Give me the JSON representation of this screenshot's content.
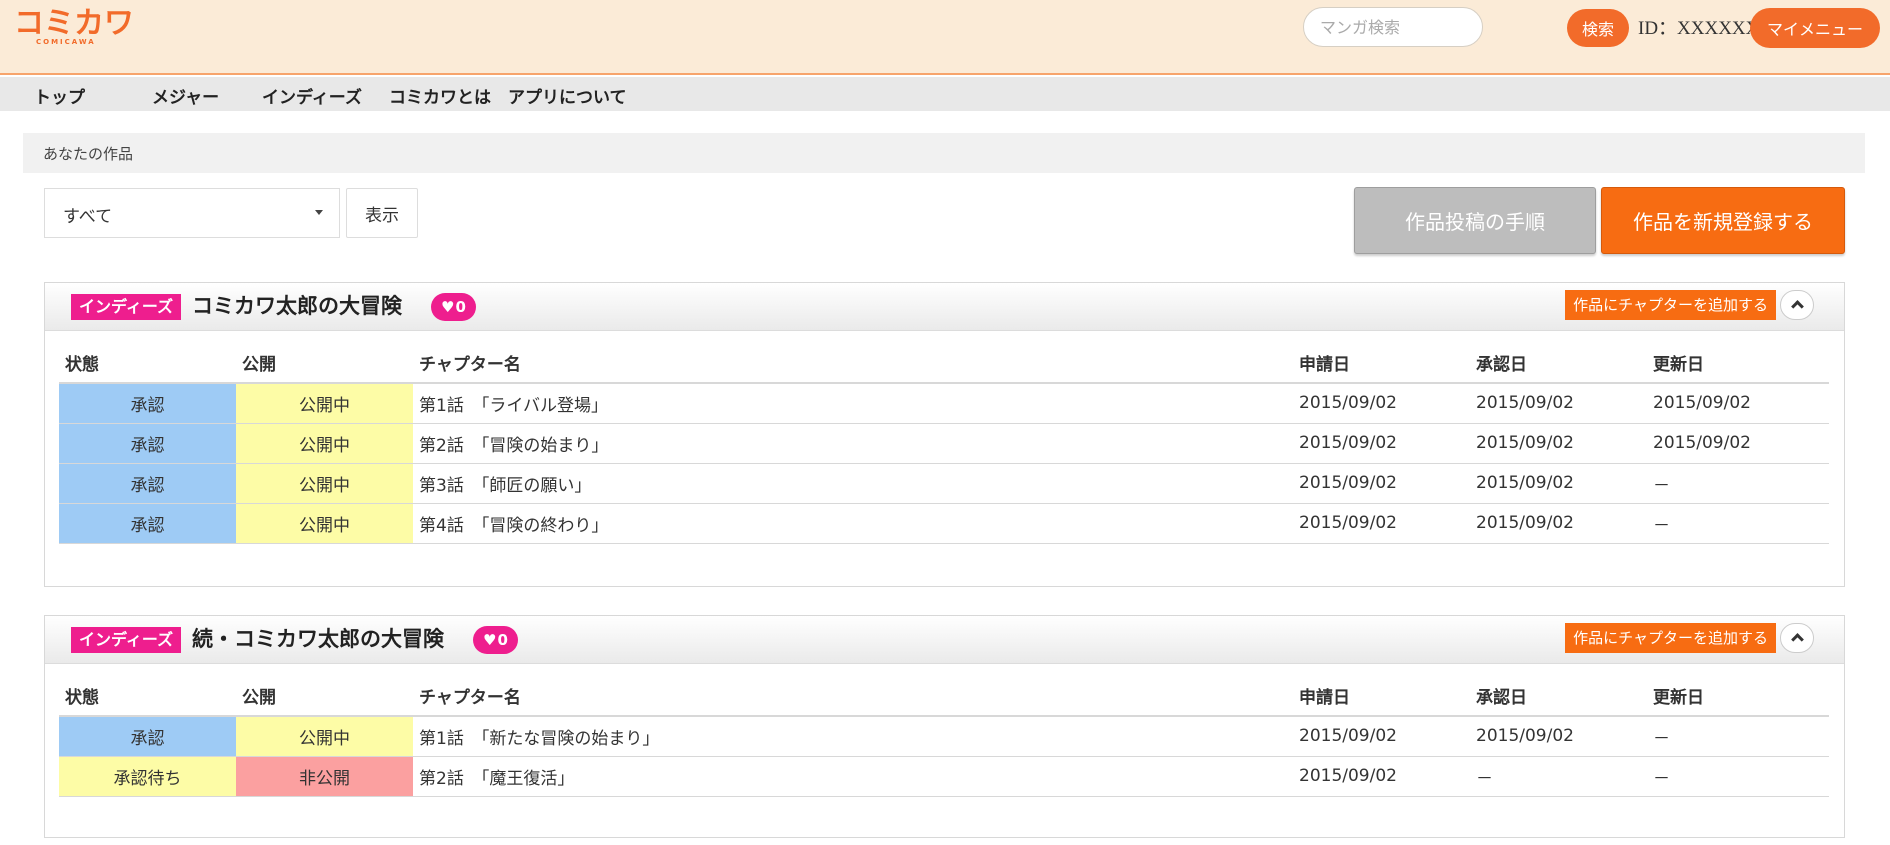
{
  "header": {
    "logo_text": "コミカワ",
    "logo_sub": "COMICAWA",
    "search_placeholder": "マンガ検索",
    "search_button": "検索",
    "user_id": "ID：XXXXXX",
    "mymenu_button": "マイメニュー",
    "colors": {
      "background": "#fbebd7",
      "accent": "#f26b2a"
    }
  },
  "nav": {
    "items": [
      "トップ",
      "メジャー",
      "インディーズ",
      "コミカワとは",
      "アプリについて"
    ]
  },
  "breadcrumb": "あなたの作品",
  "controls": {
    "filter_selected": "すべて",
    "display_button": "表示",
    "guide_button": "作品投稿の手順",
    "new_work_button": "作品を新規登録する"
  },
  "table_headers": {
    "status": "状態",
    "public": "公開",
    "chapter": "チャプター名",
    "applied": "申請日",
    "approved": "承認日",
    "updated": "更新日"
  },
  "works": [
    {
      "tag": "インディーズ",
      "title": "コミカワ太郎の大冒険",
      "likes": "0",
      "add_chapter_button": "作品にチャプターを追加する",
      "rows": [
        {
          "status": "承認",
          "status_color": "#9ecbf5",
          "public": "公開中",
          "public_color": "#fdfca6",
          "chapter": "第1話　「ライバル登場」",
          "applied": "2015/09/02",
          "approved": "2015/09/02",
          "updated": "2015/09/02"
        },
        {
          "status": "承認",
          "status_color": "#9ecbf5",
          "public": "公開中",
          "public_color": "#fdfca6",
          "chapter": "第2話　「冒険の始まり」",
          "applied": "2015/09/02",
          "approved": "2015/09/02",
          "updated": "2015/09/02"
        },
        {
          "status": "承認",
          "status_color": "#9ecbf5",
          "public": "公開中",
          "public_color": "#fdfca6",
          "chapter": "第3話　「師匠の願い」",
          "applied": "2015/09/02",
          "approved": "2015/09/02",
          "updated": "－"
        },
        {
          "status": "承認",
          "status_color": "#9ecbf5",
          "public": "公開中",
          "public_color": "#fdfca6",
          "chapter": "第4話　「冒険の終わり」",
          "applied": "2015/09/02",
          "approved": "2015/09/02",
          "updated": "－"
        }
      ]
    },
    {
      "tag": "インディーズ",
      "title": "続・コミカワ太郎の大冒険",
      "likes": "0",
      "add_chapter_button": "作品にチャプターを追加する",
      "rows": [
        {
          "status": "承認",
          "status_color": "#9ecbf5",
          "public": "公開中",
          "public_color": "#fdfca6",
          "chapter": "第1話　「新たな冒険の始まり」",
          "applied": "2015/09/02",
          "approved": "2015/09/02",
          "updated": "－"
        },
        {
          "status": "承認待ち",
          "status_color": "#fdfca6",
          "public": "非公開",
          "public_color": "#fba0a0",
          "chapter": "第2話　「魔王復活」",
          "applied": "2015/09/02",
          "approved": "－",
          "updated": "－"
        }
      ]
    }
  ]
}
